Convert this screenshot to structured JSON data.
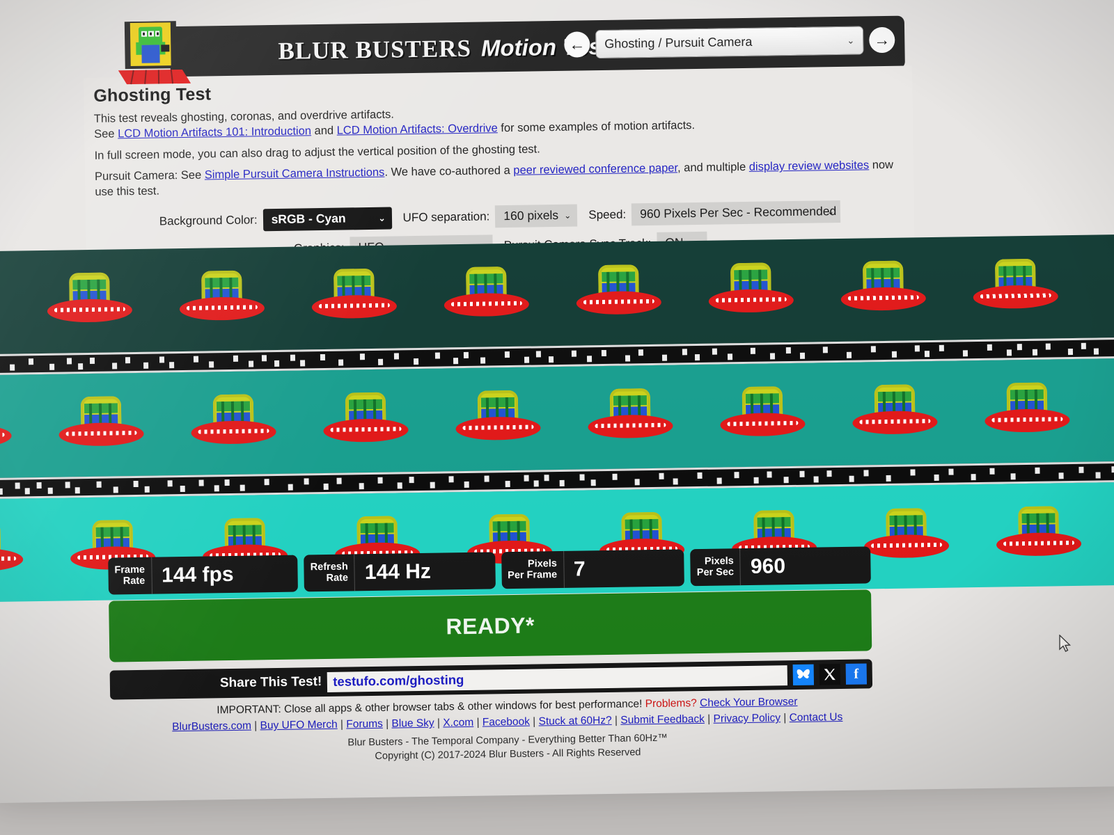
{
  "header": {
    "brand_main": "BLUR  BUSTERS",
    "brand_sub": "Motion Tests",
    "logo_name": "blur-busters-alien-logo",
    "nav": {
      "back_icon": "←",
      "forward_icon": "→",
      "selected_test": "Ghosting / Pursuit Camera",
      "caret": "⌄"
    }
  },
  "main": {
    "title": "Ghosting Test",
    "desc": {
      "l1": "This test reveals ghosting, coronas, and overdrive artifacts.",
      "l2_pre": "See ",
      "l2_link1": "LCD Motion Artifacts 101: Introduction",
      "l2_mid": " and ",
      "l2_link2": "LCD Motion Artifacts: Overdrive",
      "l2_post": " for some examples of motion artifacts.",
      "l3": "In full screen mode, you can also drag to adjust the vertical position of the ghosting test.",
      "l4_pre": "Pursuit Camera: See ",
      "l4_link1": "Simple Pursuit Camera Instructions",
      "l4_mid": ". We have co-authored a ",
      "l4_link2": "peer reviewed conference paper",
      "l4_mid2": ", and multiple ",
      "l4_link3": "display review websites",
      "l4_post": " now use this test."
    }
  },
  "controls": {
    "background_color": {
      "label": "Background Color:",
      "value": "sRGB - Cyan"
    },
    "ufo_separation": {
      "label": "UFO separation:",
      "value": "160 pixels"
    },
    "speed": {
      "label": "Speed:",
      "value": "960 Pixels Per Sec - Recommended"
    },
    "graphics": {
      "label": "Graphics:",
      "value": "UFO"
    },
    "sync_track": {
      "label": "Pursuit Camera Sync Track:",
      "value": "ON"
    },
    "caret": "⌄"
  },
  "test_area": {
    "bands": [
      {
        "name": "dark-cyan-band",
        "color": "#0d3730",
        "ufo_count": 9
      },
      {
        "name": "mid-cyan-band",
        "color": "#149c8c",
        "ufo_count": 9
      },
      {
        "name": "bright-cyan-band",
        "color": "#1fd0c0",
        "ufo_count": 9
      }
    ],
    "sync_track_color": "#070707"
  },
  "stats": [
    {
      "key_line1": "Frame",
      "key_line2": "Rate",
      "value": "144 fps"
    },
    {
      "key_line1": "Refresh",
      "key_line2": "Rate",
      "value": "144 Hz"
    },
    {
      "key_line1": "Pixels",
      "key_line2": "Per Frame",
      "value": "7"
    },
    {
      "key_line1": "Pixels",
      "key_line2": "Per Sec",
      "value": "960"
    }
  ],
  "status": {
    "text": "READY*",
    "color": "#1a7a15"
  },
  "share": {
    "title": "Share This Test!",
    "url": "testufo.com/ghosting",
    "icons": [
      {
        "name": "bluesky-icon",
        "glyph": "🦋"
      },
      {
        "name": "x-twitter-icon",
        "glyph": "✕"
      },
      {
        "name": "facebook-icon",
        "glyph": "f"
      }
    ]
  },
  "footer": {
    "important_pre": "IMPORTANT: Close all apps & other browser tabs & other windows for best performance! ",
    "problems": "Problems?",
    "check_browser": "Check Your Browser",
    "links": [
      "BlurBusters.com",
      "Buy UFO Merch",
      "Forums",
      "Blue Sky",
      "X.com",
      "Facebook",
      "Stuck at 60Hz?",
      "Submit Feedback",
      "Privacy Policy",
      "Contact Us"
    ],
    "tagline": "Blur Busters - The Temporal Company - Everything Better Than 60Hz™",
    "copyright": "Copyright (C) 2017-2024 Blur Busters - All Rights Reserved"
  },
  "cursor": {
    "name": "mouse-pointer"
  }
}
